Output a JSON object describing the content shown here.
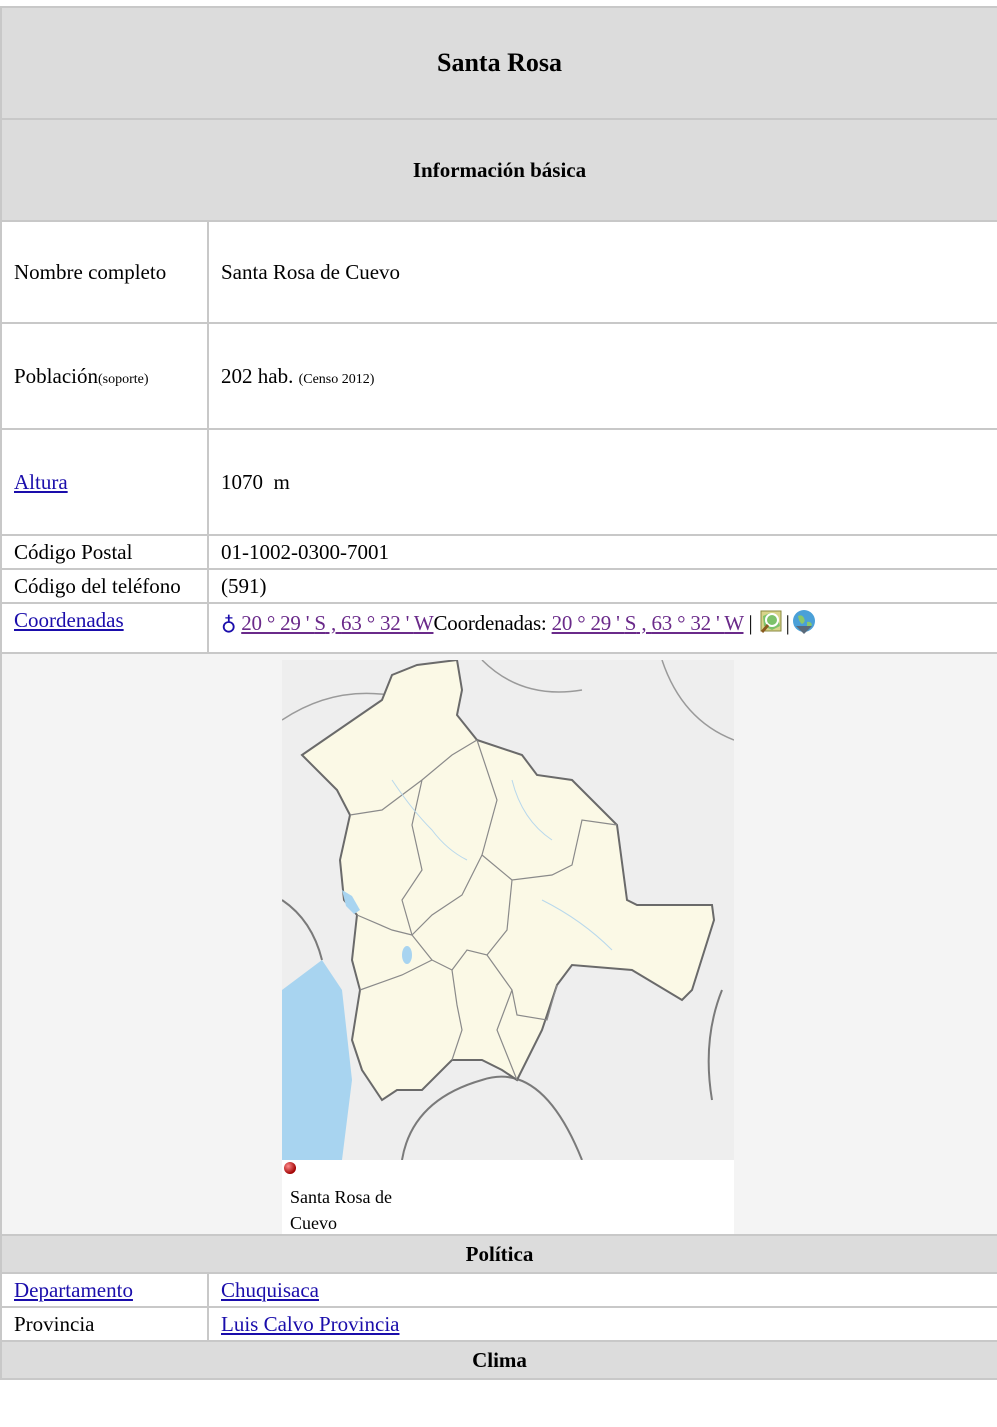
{
  "title": "Santa Rosa",
  "sections": {
    "basic": "Información básica",
    "politics": "Política",
    "climate": "Clima"
  },
  "rows": {
    "full_name": {
      "label": "Nombre completo",
      "value": "Santa Rosa de Cuevo"
    },
    "population": {
      "label": "Población",
      "label_note": "(soporte)",
      "value": "202 hab.",
      "value_note": "(Censo 2012)"
    },
    "altitude": {
      "label": "Altura",
      "value": "1070  m"
    },
    "postal": {
      "label": "Código Postal",
      "value": "01-1002-0300-7001"
    },
    "phone": {
      "label": "Código del teléfono",
      "value": "(591)"
    },
    "coords": {
      "label": "Coordenadas",
      "globe_symbol": "♁",
      "lat": "20 ° 29 ' ",
      "lat_dir": "S",
      "sep": " , ",
      "lon": "63 ° 32 ' ",
      "lon_dir": "W",
      "repeat_label": "Coordenadas: ",
      "pipe": " | ",
      "pipe2": "|"
    },
    "department": {
      "label": "Departamento",
      "value": "Chuquisaca"
    },
    "province": {
      "label": "Provincia",
      "value": "Luis Calvo Provincia"
    }
  },
  "map": {
    "caption": "Santa Rosa de Cuevo",
    "marker_color": "#cc0000"
  },
  "icons": {
    "coord_globe": "globe-symbol",
    "map_search": "map-magnifier-icon",
    "earth": "globe-icon"
  },
  "colors": {
    "header_bg": "#dcdcdc",
    "border": "#c8c8c8",
    "link": "#1a0dab",
    "visited": "#6a2a8a",
    "map_land": "#fbf9e6",
    "map_water": "#a8d4f0"
  }
}
